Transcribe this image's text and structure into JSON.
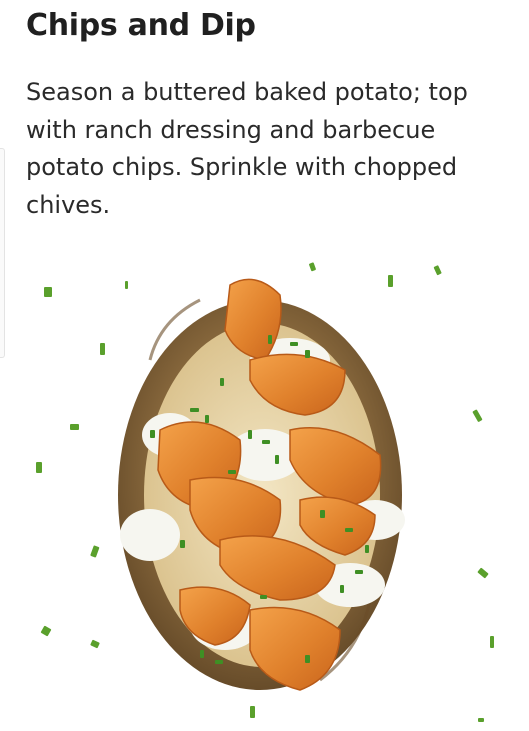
{
  "recipe": {
    "title": "Chips and Dip",
    "description": "Season a buttered baked potato; top with ranch dressing and barbecue potato chips. Sprinkle with chopped chives."
  },
  "image": {
    "subject": "baked-potato-with-chips-ranch-and-chives"
  },
  "colors": {
    "title_text": "#202020",
    "body_text": "#2a2a2a",
    "potato_skin": "#8a6a3e",
    "chip": "#e8913a",
    "ranch": "#f4f4ee",
    "chive": "#5aa02c"
  }
}
